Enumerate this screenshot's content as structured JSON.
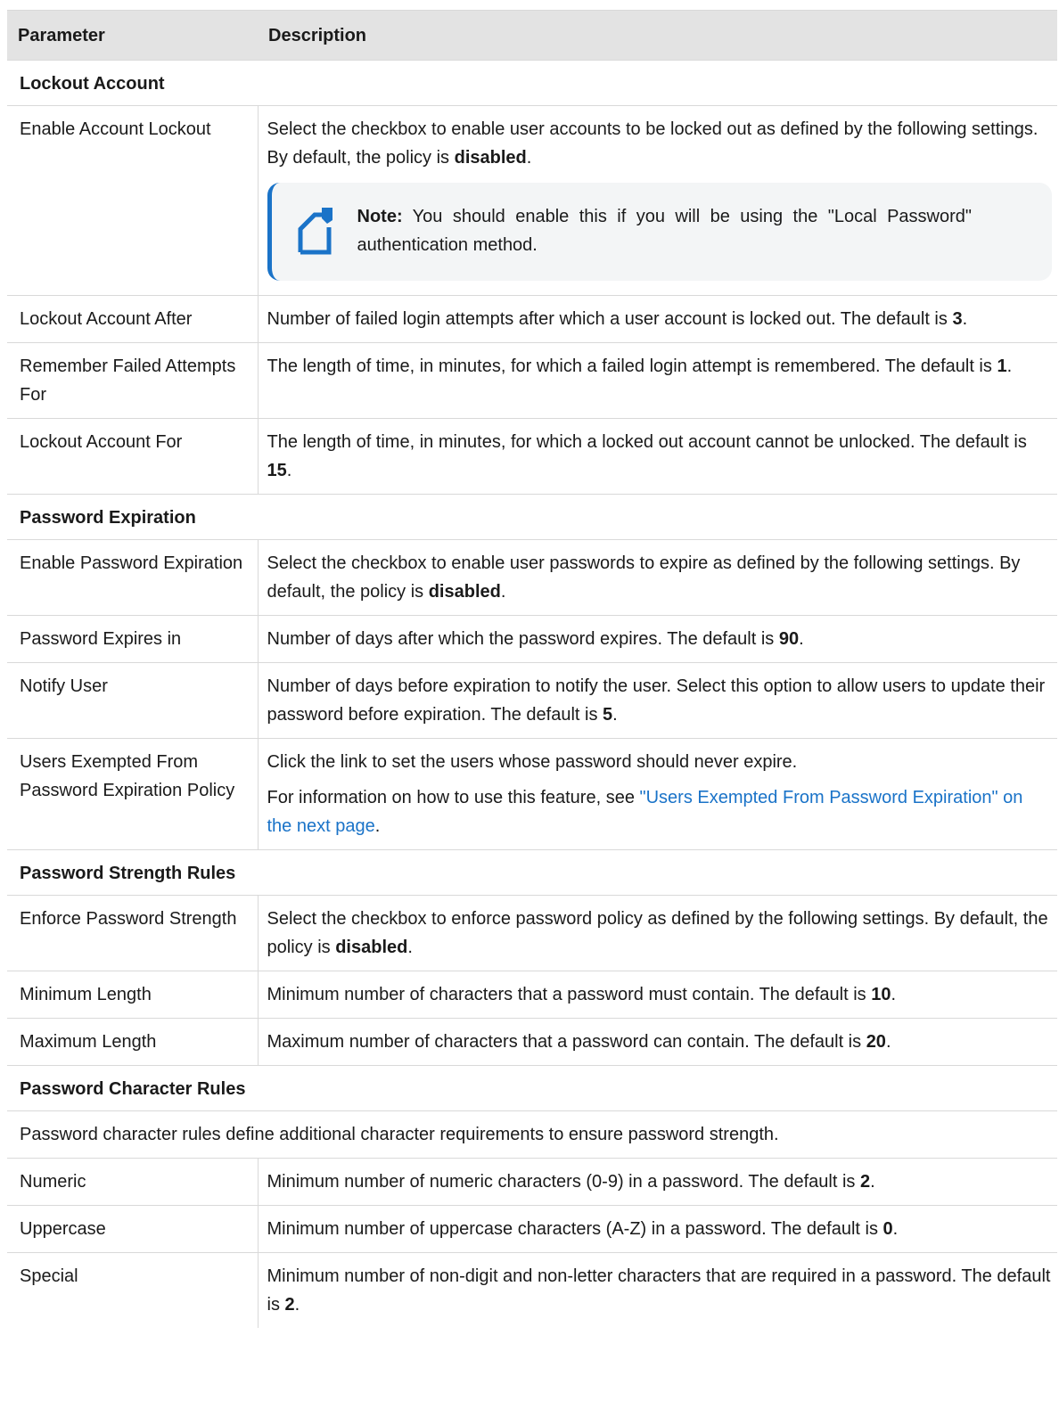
{
  "table": {
    "headers": [
      "Parameter",
      "Description"
    ],
    "sections": [
      {
        "title": "Lockout Account",
        "rows": [
          {
            "param": "Enable Account Lockout",
            "desc_pre": "Select the checkbox to enable user accounts to be locked out as defined by the following settings. By default, the policy is ",
            "desc_bold": "disabled",
            "desc_post": ".",
            "note": {
              "label": "Note:",
              "text": " You should enable this if you will be using the \"Local Password\" authentication method.",
              "icon": "note-icon"
            }
          },
          {
            "param": "Lockout Account After",
            "desc_pre": "Number of failed login attempts after which a user account is locked out. The default is ",
            "desc_bold": "3",
            "desc_post": "."
          },
          {
            "param": "Remember Failed Attempts For",
            "desc_pre": "The length of time, in minutes, for which a failed login attempt is remembered. The default is ",
            "desc_bold": "1",
            "desc_post": "."
          },
          {
            "param": "Lockout Account For",
            "desc_pre": "The length of time, in minutes, for which a locked out account cannot be unlocked. The default is ",
            "desc_bold": "15",
            "desc_post": "."
          }
        ]
      },
      {
        "title": "Password Expiration",
        "rows": [
          {
            "param": "Enable Password Expiration",
            "desc_pre": "Select the checkbox to enable user passwords to expire as defined by the following settings. By default, the policy is ",
            "desc_bold": "disabled",
            "desc_post": "."
          },
          {
            "param": "Password Expires in",
            "desc_pre": "Number of days after which the password expires. The default is ",
            "desc_bold": "90",
            "desc_post": "."
          },
          {
            "param": "Notify User",
            "desc_pre": "Number of days before expiration to notify the user. Select this option to allow users to update their password before expiration. The default is ",
            "desc_bold": "5",
            "desc_post": "."
          },
          {
            "param": "Users Exempted From Password Expiration Policy",
            "desc_line1": "Click the link to set the users whose password should never expire.",
            "desc_link_pre": "For information on how to use this feature, see ",
            "desc_link": "\"Users Exempted From Password Expiration\" on the next page",
            "desc_link_post": "."
          }
        ]
      },
      {
        "title": "Password Strength Rules",
        "rows": [
          {
            "param": "Enforce Password Strength",
            "desc_pre": "Select the checkbox to enforce password policy as defined by the following settings. By default, the policy is ",
            "desc_bold": "disabled",
            "desc_post": "."
          },
          {
            "param": "Minimum Length",
            "desc_pre": "Minimum number of characters that a password must contain. The default is ",
            "desc_bold": "10",
            "desc_post": "."
          },
          {
            "param": "Maximum Length",
            "desc_pre": "Maximum number of characters that a password can contain. The default is ",
            "desc_bold": "20",
            "desc_post": "."
          }
        ]
      },
      {
        "title": "Password Character Rules",
        "intro": "Password character rules define additional character requirements to ensure password strength.",
        "rows": [
          {
            "param": "Numeric",
            "desc_pre": "Minimum number of numeric characters (0-9) in a password. The default is ",
            "desc_bold": "2",
            "desc_post": "."
          },
          {
            "param": "Uppercase",
            "desc_pre": "Minimum number of uppercase characters (A-Z) in a password. The default is ",
            "desc_bold": "0",
            "desc_post": "."
          },
          {
            "param": "Special",
            "desc_pre": "Minimum number of non-digit and non-letter characters that are required in a password. The default is ",
            "desc_bold": "2",
            "desc_post": "."
          }
        ]
      }
    ]
  },
  "colors": {
    "header_bg": "#e3e3e3",
    "border": "#d9d9d9",
    "link": "#1a73c8",
    "note_bg": "#f3f5f6",
    "note_accent": "#1a73c8"
  }
}
